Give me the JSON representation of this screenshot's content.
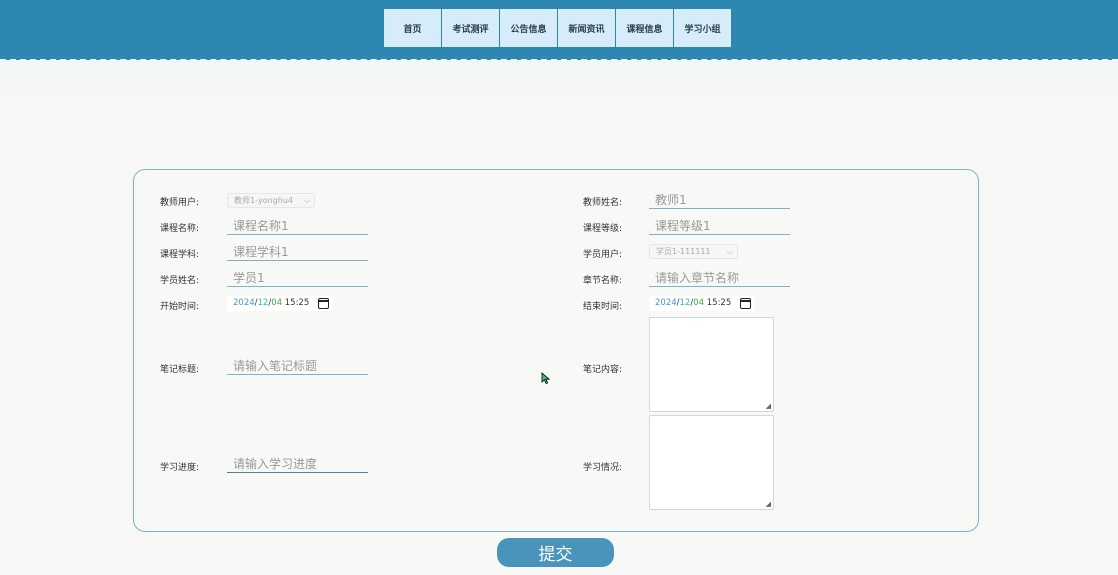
{
  "nav": [
    "首页",
    "考试测评",
    "公告信息",
    "新闻资讯",
    "课程信息",
    "学习小组"
  ],
  "left": {
    "teacher_user": {
      "label": "教师用户:",
      "value": "教师1-yonghu4"
    },
    "course_name": {
      "label": "课程名称:",
      "value": "课程名称1"
    },
    "course_subject": {
      "label": "课程学科:",
      "value": "课程学科1"
    },
    "student_name": {
      "label": "学员姓名:",
      "value": "学员1"
    },
    "start_time": {
      "label": "开始时间:",
      "year": "2024",
      "month": "12",
      "day": "04",
      "time": "15:25"
    },
    "note_title": {
      "label": "笔记标题:",
      "placeholder": "请输入笔记标题"
    },
    "progress": {
      "label": "学习进度:",
      "placeholder": "请输入学习进度"
    }
  },
  "right": {
    "teacher_name": {
      "label": "教师姓名:",
      "value": "教师1"
    },
    "course_level": {
      "label": "课程等级:",
      "value": "课程等级1"
    },
    "student_user": {
      "label": "学员用户:",
      "value": "学员1-111111"
    },
    "chapter_name": {
      "label": "章节名称:",
      "placeholder": "请输入章节名称"
    },
    "end_time": {
      "label": "结束时间:",
      "year": "2024",
      "month": "12",
      "day": "04",
      "time": "15:25"
    },
    "note_content": {
      "label": "笔记内容:"
    },
    "situation": {
      "label": "学习情况:"
    }
  },
  "submit": "提交",
  "colors": {
    "header": "#2e87b0",
    "nav_bg": "#d7ecf9",
    "border": "#7fb1cc",
    "button": "#4a94bb"
  }
}
